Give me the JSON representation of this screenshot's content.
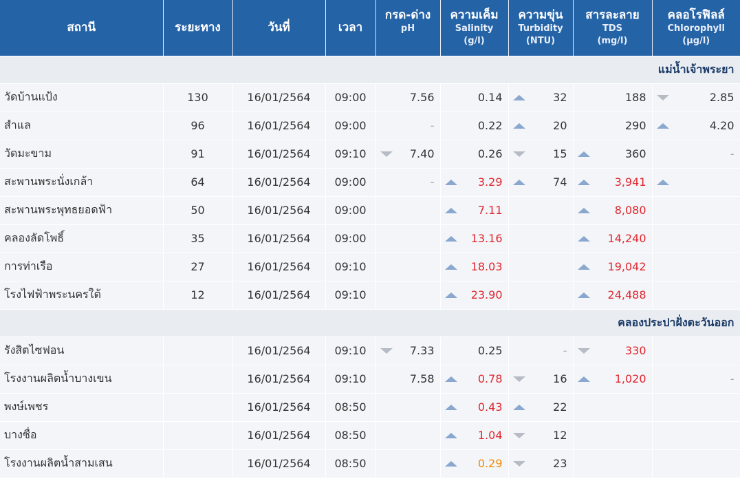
{
  "colors": {
    "header_bg": "#2563a7",
    "row_bg": "#f3f5f8",
    "red": "#e0262e",
    "orange": "#f08a00",
    "up_arrow": "#8aa8cf",
    "down_arrow": "#b7bcc4"
  },
  "header": {
    "station": "สถานี",
    "distance": "ระยะทาง",
    "date": "วันที่",
    "time": "เวลา",
    "ph": {
      "th": "กรด-ด่าง",
      "en": "pH",
      "unit": ""
    },
    "salinity": {
      "th": "ความเค็ม",
      "en": "Salinity",
      "unit": "(g/l)"
    },
    "turbidity": {
      "th": "ความขุ่น",
      "en": "Turbidity",
      "unit": "(NTU)"
    },
    "tds": {
      "th": "สารละลาย",
      "en": "TDS",
      "unit": "(mg/l)"
    },
    "chlorophyll": {
      "th": "คลอโรฟิลล์",
      "en": "Chlorophyll",
      "unit": "(µg/l)"
    }
  },
  "groups": [
    {
      "name": "แม่น้ำเจ้าพระยา",
      "rows": [
        {
          "station": "วัดบ้านแป้ง",
          "distance": "130",
          "date": "16/01/2564",
          "time": "09:00",
          "ph": {
            "v": "7.56",
            "icon": "",
            "c": ""
          },
          "sal": {
            "v": "0.14",
            "icon": "",
            "c": ""
          },
          "tur": {
            "v": "32",
            "icon": "up",
            "c": ""
          },
          "tds": {
            "v": "188",
            "icon": "",
            "c": ""
          },
          "chl": {
            "v": "2.85",
            "icon": "down",
            "c": ""
          }
        },
        {
          "station": "สำแล",
          "distance": "96",
          "date": "16/01/2564",
          "time": "09:00",
          "ph": {
            "v": "-",
            "icon": "",
            "c": "dash"
          },
          "sal": {
            "v": "0.22",
            "icon": "",
            "c": ""
          },
          "tur": {
            "v": "20",
            "icon": "up",
            "c": ""
          },
          "tds": {
            "v": "290",
            "icon": "",
            "c": ""
          },
          "chl": {
            "v": "4.20",
            "icon": "up",
            "c": ""
          }
        },
        {
          "station": "วัดมะขาม",
          "distance": "91",
          "date": "16/01/2564",
          "time": "09:10",
          "ph": {
            "v": "7.40",
            "icon": "down",
            "c": ""
          },
          "sal": {
            "v": "0.26",
            "icon": "",
            "c": ""
          },
          "tur": {
            "v": "15",
            "icon": "down",
            "c": ""
          },
          "tds": {
            "v": "360",
            "icon": "up",
            "c": ""
          },
          "chl": {
            "v": "-",
            "icon": "",
            "c": "dash"
          }
        },
        {
          "station": "สะพานพระนั่งเกล้า",
          "distance": "64",
          "date": "16/01/2564",
          "time": "09:00",
          "ph": {
            "v": "-",
            "icon": "",
            "c": "dash"
          },
          "sal": {
            "v": "3.29",
            "icon": "up",
            "c": "red"
          },
          "tur": {
            "v": "74",
            "icon": "up",
            "c": ""
          },
          "tds": {
            "v": "3,941",
            "icon": "up",
            "c": "red"
          },
          "chl": {
            "v": "",
            "icon": "up",
            "c": ""
          }
        },
        {
          "station": "สะพานพระพุทธยอดฟ้า",
          "distance": "50",
          "date": "16/01/2564",
          "time": "09:00",
          "ph": {
            "v": "",
            "icon": "",
            "c": ""
          },
          "sal": {
            "v": "7.11",
            "icon": "up",
            "c": "red"
          },
          "tur": {
            "v": "",
            "icon": "",
            "c": ""
          },
          "tds": {
            "v": "8,080",
            "icon": "up",
            "c": "red"
          },
          "chl": {
            "v": "",
            "icon": "",
            "c": ""
          }
        },
        {
          "station": "คลองลัดโพธิ์",
          "distance": "35",
          "date": "16/01/2564",
          "time": "09:00",
          "ph": {
            "v": "",
            "icon": "",
            "c": ""
          },
          "sal": {
            "v": "13.16",
            "icon": "up",
            "c": "red"
          },
          "tur": {
            "v": "",
            "icon": "",
            "c": ""
          },
          "tds": {
            "v": "14,240",
            "icon": "up",
            "c": "red"
          },
          "chl": {
            "v": "",
            "icon": "",
            "c": ""
          }
        },
        {
          "station": "การท่าเรือ",
          "distance": "27",
          "date": "16/01/2564",
          "time": "09:10",
          "ph": {
            "v": "",
            "icon": "",
            "c": ""
          },
          "sal": {
            "v": "18.03",
            "icon": "up",
            "c": "red"
          },
          "tur": {
            "v": "",
            "icon": "",
            "c": ""
          },
          "tds": {
            "v": "19,042",
            "icon": "up",
            "c": "red"
          },
          "chl": {
            "v": "",
            "icon": "",
            "c": ""
          }
        },
        {
          "station": "โรงไฟฟ้าพระนครใต้",
          "distance": "12",
          "date": "16/01/2564",
          "time": "09:10",
          "ph": {
            "v": "",
            "icon": "",
            "c": ""
          },
          "sal": {
            "v": "23.90",
            "icon": "up",
            "c": "red"
          },
          "tur": {
            "v": "",
            "icon": "",
            "c": ""
          },
          "tds": {
            "v": "24,488",
            "icon": "up",
            "c": "red"
          },
          "chl": {
            "v": "",
            "icon": "",
            "c": ""
          }
        }
      ]
    },
    {
      "name": "คลองประปาฝั่งตะวันออก",
      "rows": [
        {
          "station": "รังสิตไซฟอน",
          "distance": "",
          "date": "16/01/2564",
          "time": "09:10",
          "ph": {
            "v": "7.33",
            "icon": "down",
            "c": ""
          },
          "sal": {
            "v": "0.25",
            "icon": "",
            "c": ""
          },
          "tur": {
            "v": "-",
            "icon": "",
            "c": "dash"
          },
          "tds": {
            "v": "330",
            "icon": "down",
            "c": "red"
          },
          "chl": {
            "v": "",
            "icon": "",
            "c": ""
          }
        },
        {
          "station": "โรงงานผลิตน้ำบางเขน",
          "distance": "",
          "date": "16/01/2564",
          "time": "09:10",
          "ph": {
            "v": "7.58",
            "icon": "",
            "c": ""
          },
          "sal": {
            "v": "0.78",
            "icon": "up",
            "c": "red"
          },
          "tur": {
            "v": "16",
            "icon": "down",
            "c": ""
          },
          "tds": {
            "v": "1,020",
            "icon": "up",
            "c": "red"
          },
          "chl": {
            "v": "-",
            "icon": "",
            "c": "dash"
          }
        },
        {
          "station": "พงษ์เพชร",
          "distance": "",
          "date": "16/01/2564",
          "time": "08:50",
          "ph": {
            "v": "",
            "icon": "",
            "c": ""
          },
          "sal": {
            "v": "0.43",
            "icon": "up",
            "c": "red"
          },
          "tur": {
            "v": "22",
            "icon": "up",
            "c": ""
          },
          "tds": {
            "v": "",
            "icon": "",
            "c": ""
          },
          "chl": {
            "v": "",
            "icon": "",
            "c": ""
          }
        },
        {
          "station": "บางซื่อ",
          "distance": "",
          "date": "16/01/2564",
          "time": "08:50",
          "ph": {
            "v": "",
            "icon": "",
            "c": ""
          },
          "sal": {
            "v": "1.04",
            "icon": "up",
            "c": "red"
          },
          "tur": {
            "v": "12",
            "icon": "down",
            "c": ""
          },
          "tds": {
            "v": "",
            "icon": "",
            "c": ""
          },
          "chl": {
            "v": "",
            "icon": "",
            "c": ""
          }
        },
        {
          "station": "โรงงานผลิตน้ำสามเสน",
          "distance": "",
          "date": "16/01/2564",
          "time": "08:50",
          "ph": {
            "v": "",
            "icon": "",
            "c": ""
          },
          "sal": {
            "v": "0.29",
            "icon": "up",
            "c": "orange"
          },
          "tur": {
            "v": "23",
            "icon": "down",
            "c": ""
          },
          "tds": {
            "v": "",
            "icon": "",
            "c": ""
          },
          "chl": {
            "v": "",
            "icon": "",
            "c": ""
          }
        }
      ]
    }
  ]
}
